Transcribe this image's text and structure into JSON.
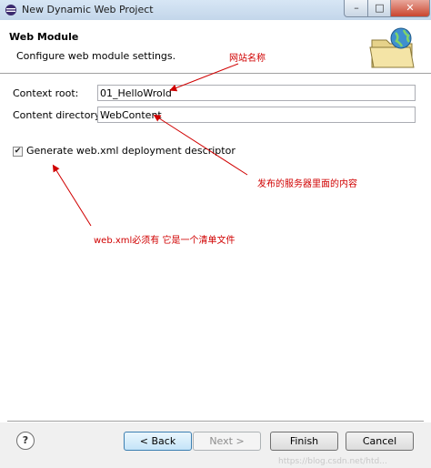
{
  "window": {
    "title": "New Dynamic Web Project",
    "minimize_glyph": "–",
    "maximize_glyph": "□",
    "close_glyph": "✕"
  },
  "banner": {
    "title": "Web Module",
    "description": "Configure web module settings."
  },
  "form": {
    "context_root": {
      "label": "Context root:",
      "value": "01_HelloWrold"
    },
    "content_directory": {
      "label": "Content directory:",
      "value": "WebContent"
    },
    "generate_descriptor": {
      "label": "Generate web.xml deployment descriptor",
      "checked": true,
      "check_glyph": "✔"
    }
  },
  "annotations": {
    "website_name": "网站名称",
    "server_content": "发布的服务器里面的内容",
    "webxml_note": "web.xml必须有 它是一个清单文件",
    "color": "#d00000"
  },
  "footer": {
    "help_glyph": "?",
    "back_label": "< Back",
    "next_label": "Next >",
    "finish_label": "Finish",
    "cancel_label": "Cancel",
    "watermark": "https://blog.csdn.net/htd..."
  }
}
